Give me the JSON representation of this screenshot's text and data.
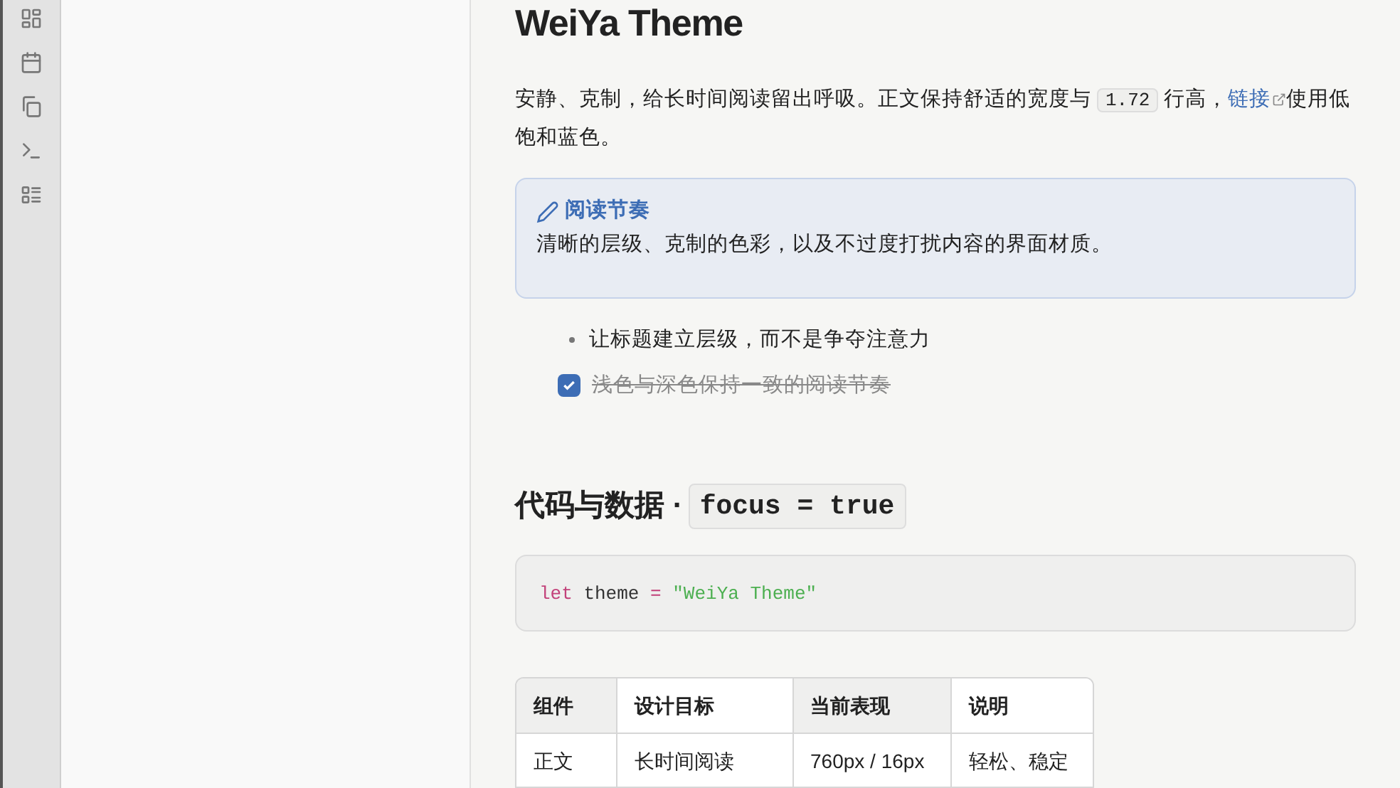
{
  "rail": {
    "items": [
      {
        "kind": "grid"
      },
      {
        "kind": "calendar"
      },
      {
        "kind": "copy"
      },
      {
        "kind": "terminal"
      },
      {
        "kind": "list"
      }
    ]
  },
  "document": {
    "title": "WeiYa Theme",
    "intro": {
      "before": "安静、克制，给长时间阅读留出呼吸。正文保持舒适的宽度与",
      "code": "1.72",
      "middle": "行高，",
      "link": "链接",
      "after": "使用低饱和蓝色。"
    },
    "callout": {
      "title": "阅读节奏",
      "body": "清晰的层级、克制的色彩，以及不过度打扰内容的界面材质。"
    },
    "list": [
      {
        "kind": "bullet",
        "text": "让标题建立层级，而不是争夺注意力"
      },
      {
        "kind": "task",
        "text": "浅色与深色保持一致的阅读节奏",
        "checked": true
      }
    ],
    "heading2": {
      "text": "代码与数据 ·",
      "code": "focus = true"
    },
    "code_block": [
      {
        "kind": "keyword",
        "text": "let"
      },
      {
        "kind": "plain",
        "text": "theme"
      },
      {
        "kind": "operator",
        "text": "="
      },
      {
        "kind": "string",
        "text": "\"WeiYa Theme\""
      }
    ],
    "table": {
      "columns": [
        {
          "label": "组件",
          "shaded": true
        },
        {
          "label": "设计目标",
          "shaded": false
        },
        {
          "label": "当前表现",
          "shaded": true
        },
        {
          "label": "说明",
          "shaded": false
        }
      ],
      "rows": [
        [
          "正文",
          "长时间阅读",
          "760px / 16px",
          "轻松、稳定"
        ]
      ]
    }
  }
}
